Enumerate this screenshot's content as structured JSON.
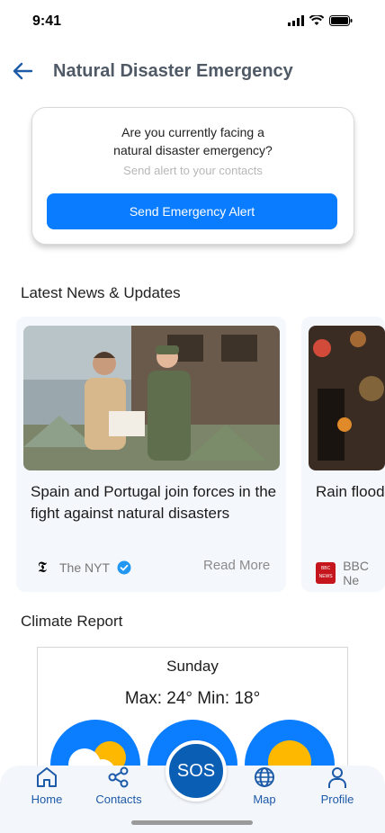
{
  "status_bar": {
    "time": "9:41"
  },
  "header": {
    "title": "Natural Disaster Emergency"
  },
  "alert": {
    "question": "Are you currently facing a natural disaster emergency?",
    "subtext": "Send alert to your contacts",
    "button_label": "Send Emergency Alert"
  },
  "news": {
    "section_title": "Latest News & Updates",
    "items": [
      {
        "headline": "Spain and Portugal join forces in the fight against natural disasters",
        "source": "The NYT",
        "source_logo": "𝕿",
        "verified": true,
        "read_more": "Read More"
      },
      {
        "headline": "Rain flood third time",
        "source": "BBC Ne",
        "source_logo": "BBC NEWS",
        "verified": false
      }
    ]
  },
  "climate": {
    "section_title": "Climate Report",
    "day": "Sunday",
    "temperature": "Max: 24° Min: 18°"
  },
  "nav": {
    "items": [
      {
        "label": "Home",
        "icon": "home-icon"
      },
      {
        "label": "Contacts",
        "icon": "share-icon"
      },
      {
        "label": "Map",
        "icon": "globe-icon"
      },
      {
        "label": "Profile",
        "icon": "user-icon"
      }
    ],
    "sos_label": "SOS"
  },
  "colors": {
    "accent": "#0a7cff",
    "nav_blue": "#1d5aa8",
    "sos": "#0a5eb4"
  }
}
